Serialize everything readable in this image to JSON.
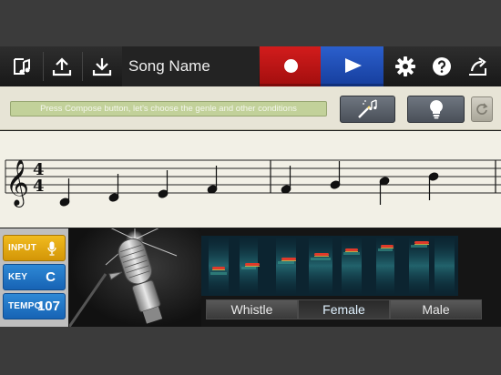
{
  "toolbar": {
    "song_name": "Song Name",
    "icons": [
      "music-library-icon",
      "upload-icon",
      "download-icon",
      "record-icon",
      "play-icon",
      "gear-icon",
      "help-icon",
      "share-icon"
    ]
  },
  "info": {
    "message": "Press Compose button, let's choose the genle and other conditions"
  },
  "staff": {
    "clef": "treble",
    "time_signature": "4/4"
  },
  "side": {
    "input_label": "INPUT",
    "key_label": "KEY",
    "key_value": "C",
    "tempo_label": "TEMPO",
    "tempo_value": "107"
  },
  "voice_tabs": [
    "Whistle",
    "Female",
    "Male"
  ],
  "colors": {
    "record": "#c0151b",
    "play": "#1f4fb8",
    "input_pill": "#e4a812",
    "key_pill": "#1f74c6",
    "message_bar": "#c2d19a"
  }
}
